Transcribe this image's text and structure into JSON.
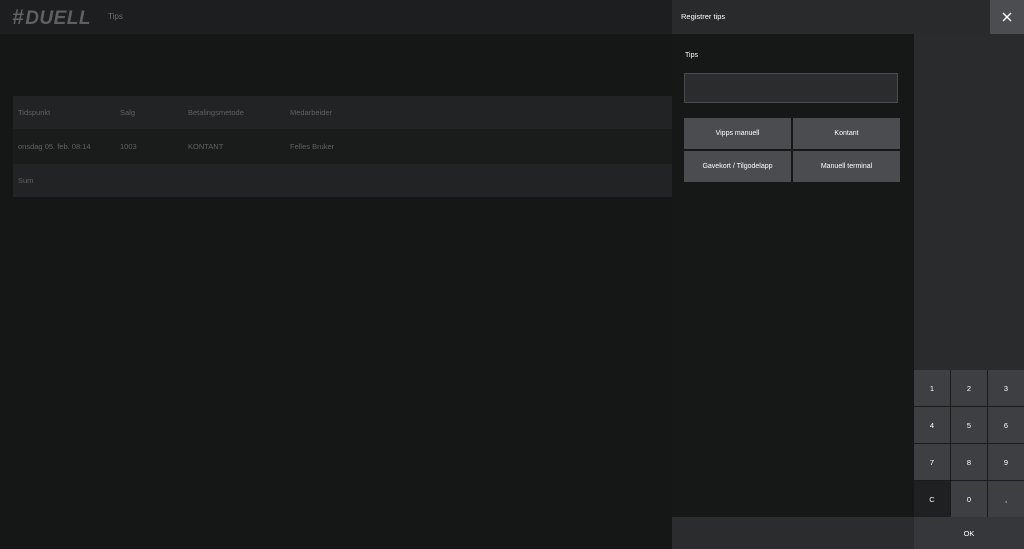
{
  "app": {
    "logo": "DUELL",
    "page_title": "Tips"
  },
  "table": {
    "headers": [
      "Tidspunkt",
      "Salg",
      "Betalingsmetode",
      "Medarbeider"
    ],
    "rows": [
      [
        "onsdag 05. feb. 08:14",
        "1003",
        "KONTANT",
        "Felles Bruker"
      ]
    ],
    "sum_label": "Sum"
  },
  "dialog": {
    "title": "Registrer tips",
    "field_label": "Tips",
    "input_value": "",
    "payment_methods": [
      "Vipps manuell",
      "Kontant",
      "Gavekort / Tilgodelapp",
      "Manuell terminal"
    ],
    "keypad": [
      "1",
      "2",
      "3",
      "4",
      "5",
      "6",
      "7",
      "8",
      "9",
      "C",
      "0",
      ","
    ],
    "ok_label": "OK"
  },
  "icons": {
    "close": "close-icon"
  },
  "colors": {
    "background": "#151616",
    "panel": "#1a1b1b",
    "button": "#4a4c4f",
    "close_button": "#4b4d50"
  }
}
